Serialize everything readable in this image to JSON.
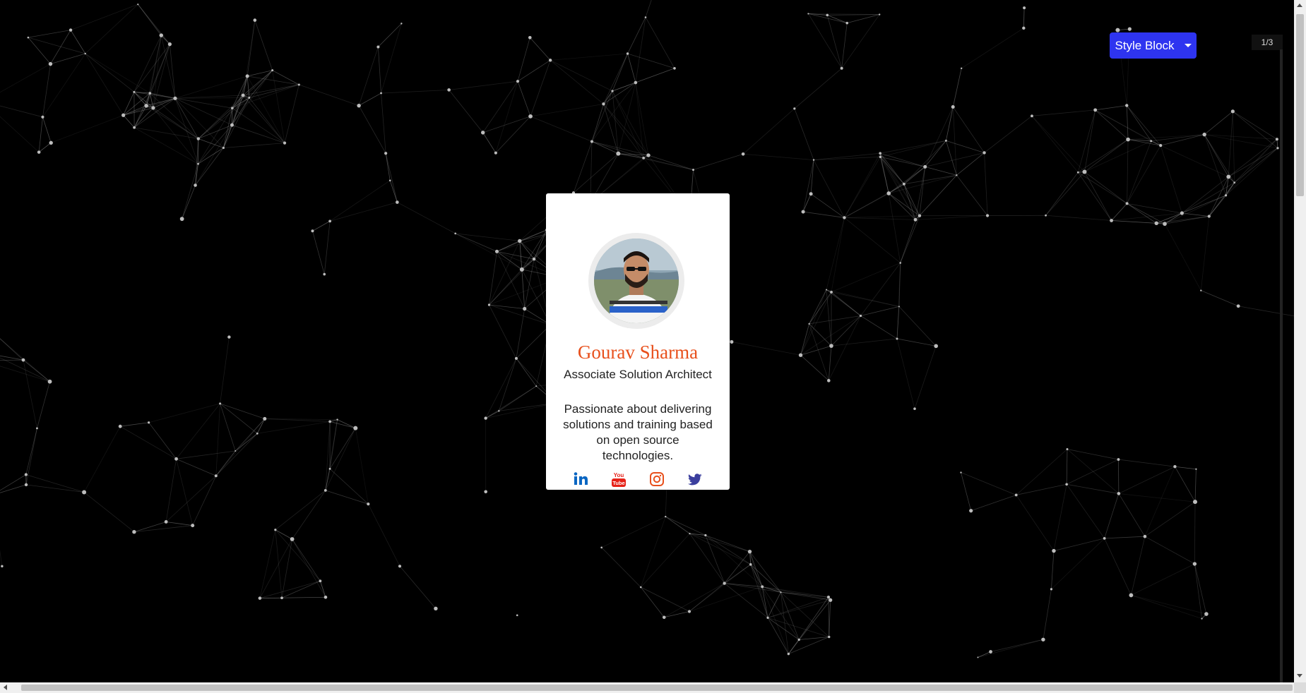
{
  "profile": {
    "name": "Gourav Sharma",
    "role": "Associate Solution Architect",
    "bio": "Passionate about delivering solutions and training based on open source technologies.",
    "avatar_icon": "person-photo"
  },
  "socials": [
    {
      "icon": "linkedin-icon",
      "color": "#0a66c2"
    },
    {
      "icon": "youtube-icon",
      "color": "#e62117"
    },
    {
      "icon": "instagram-icon",
      "color": "#e8501c"
    },
    {
      "icon": "twitter-icon",
      "color": "#3b3f9e"
    }
  ],
  "toolbar": {
    "style_button_label": "Style Block",
    "page_counter": "1/3"
  },
  "colors": {
    "background": "#000000",
    "accent_button": "#2e34f0",
    "name_color": "#e8501c"
  }
}
